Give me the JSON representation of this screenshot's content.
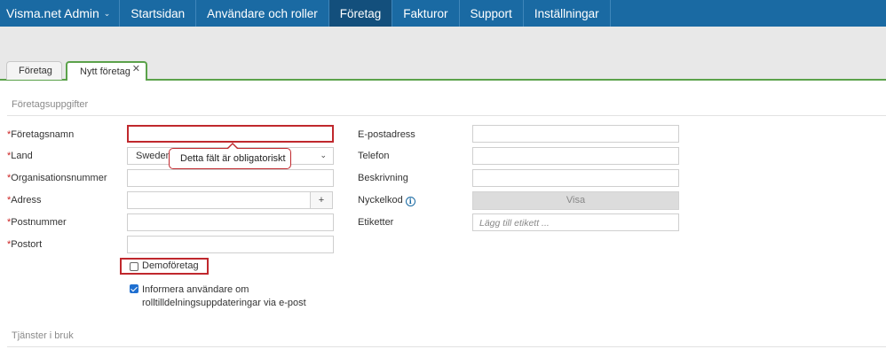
{
  "nav": {
    "brand": "Visma.net Admin",
    "items": [
      "Startsidan",
      "Användare och roller",
      "Företag",
      "Fakturor",
      "Support",
      "Inställningar"
    ],
    "active_index": 2
  },
  "tabs": [
    {
      "label": "Företag"
    },
    {
      "label": "Nytt företag",
      "closable": true
    }
  ],
  "form": {
    "section_title": "Företagsuppgifter",
    "required_marker": "*",
    "left_fields": {
      "company_name": {
        "label": "Företagsnamn",
        "value": "",
        "required": true
      },
      "country": {
        "label": "Land",
        "value": "Sweden",
        "required": true
      },
      "org_number": {
        "label": "Organisationsnummer",
        "value": "",
        "required": true
      },
      "address": {
        "label": "Adress",
        "value": "",
        "required": true,
        "add_label": "+"
      },
      "postal_code": {
        "label": "Postnummer",
        "value": "",
        "required": true
      },
      "city": {
        "label": "Postort",
        "value": "",
        "required": true
      }
    },
    "right_fields": {
      "email": {
        "label": "E-postadress",
        "value": ""
      },
      "phone": {
        "label": "Telefon",
        "value": ""
      },
      "description": {
        "label": "Beskrivning",
        "value": ""
      },
      "key_code": {
        "label": "Nyckelkod",
        "button_label": "Visa"
      },
      "tags": {
        "label": "Etiketter",
        "placeholder": "Lägg till etikett ..."
      }
    },
    "tooltip": "Detta fält är obligatoriskt",
    "demo_company": {
      "label": "Demoföretag",
      "checked": false
    },
    "notify": {
      "label_line1": "Informera användare om",
      "label_line2": "rolltilldelningsuppdateringar via e-post",
      "checked": true
    }
  },
  "services": {
    "section_title": "Tjänster i bruk"
  },
  "colors": {
    "nav_bg": "#1a6aa3",
    "nav_active": "#134f7c",
    "tab_accent": "#5ba24a",
    "error": "#c0282d",
    "required": "#cc2222"
  }
}
